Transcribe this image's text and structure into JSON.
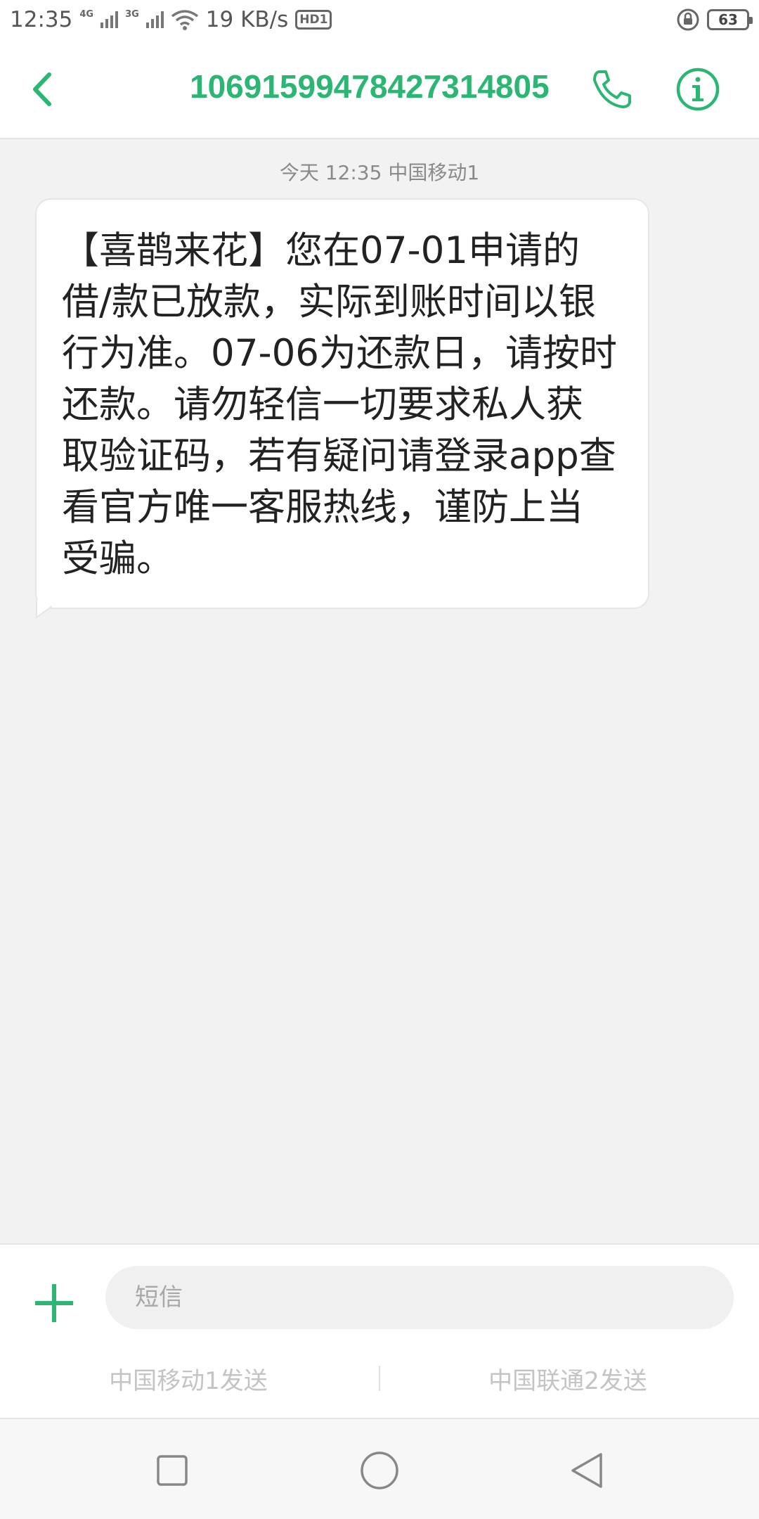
{
  "status_bar": {
    "time": "12:35",
    "network1": "4G",
    "network2": "3G",
    "speed": "19 KB/s",
    "hd": "HD1",
    "battery": "63"
  },
  "header": {
    "contact": "10691599478427314805",
    "back_icon": "chevron-left-icon",
    "call_icon": "phone-icon",
    "info_icon": "info-icon",
    "accent_color": "#2bb673"
  },
  "conversation": {
    "timestamp": "今天 12:35  中国移动1",
    "message": "【喜鹊来花】您在07-01申请的借/款已放款，实际到账时间以银行为准。07-06为还款日，请按时还款。请勿轻信一切要求私人获取验证码，若有疑问请登录app查看官方唯一客服热线，谨防上当受骗。"
  },
  "compose": {
    "placeholder": "短信",
    "send_sim1": "中国移动1发送",
    "send_sim2": "中国联通2发送"
  },
  "nav": {
    "recents_icon": "square-icon",
    "home_icon": "circle-icon",
    "back_icon": "triangle-back-icon"
  }
}
